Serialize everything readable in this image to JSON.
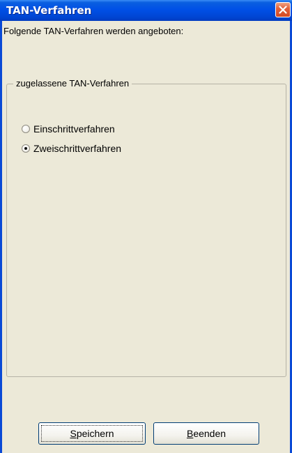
{
  "window": {
    "title": "TAN-Verfahren"
  },
  "main": {
    "intro_text": "Folgende TAN-Verfahren werden angeboten:",
    "group": {
      "legend": "zugelassene TAN-Verfahren",
      "options": [
        {
          "label": "Einschrittverfahren",
          "selected": false
        },
        {
          "label": "Zweischrittverfahren",
          "selected": true
        }
      ]
    }
  },
  "buttons": {
    "save_first": "S",
    "save_rest": "peichern",
    "end_first": "B",
    "end_rest": "eenden"
  },
  "colors": {
    "titlebar": "#0050e6",
    "client_background": "#ece9d8",
    "close_button": "#d64a23"
  },
  "icons": {
    "close": "close-icon"
  }
}
